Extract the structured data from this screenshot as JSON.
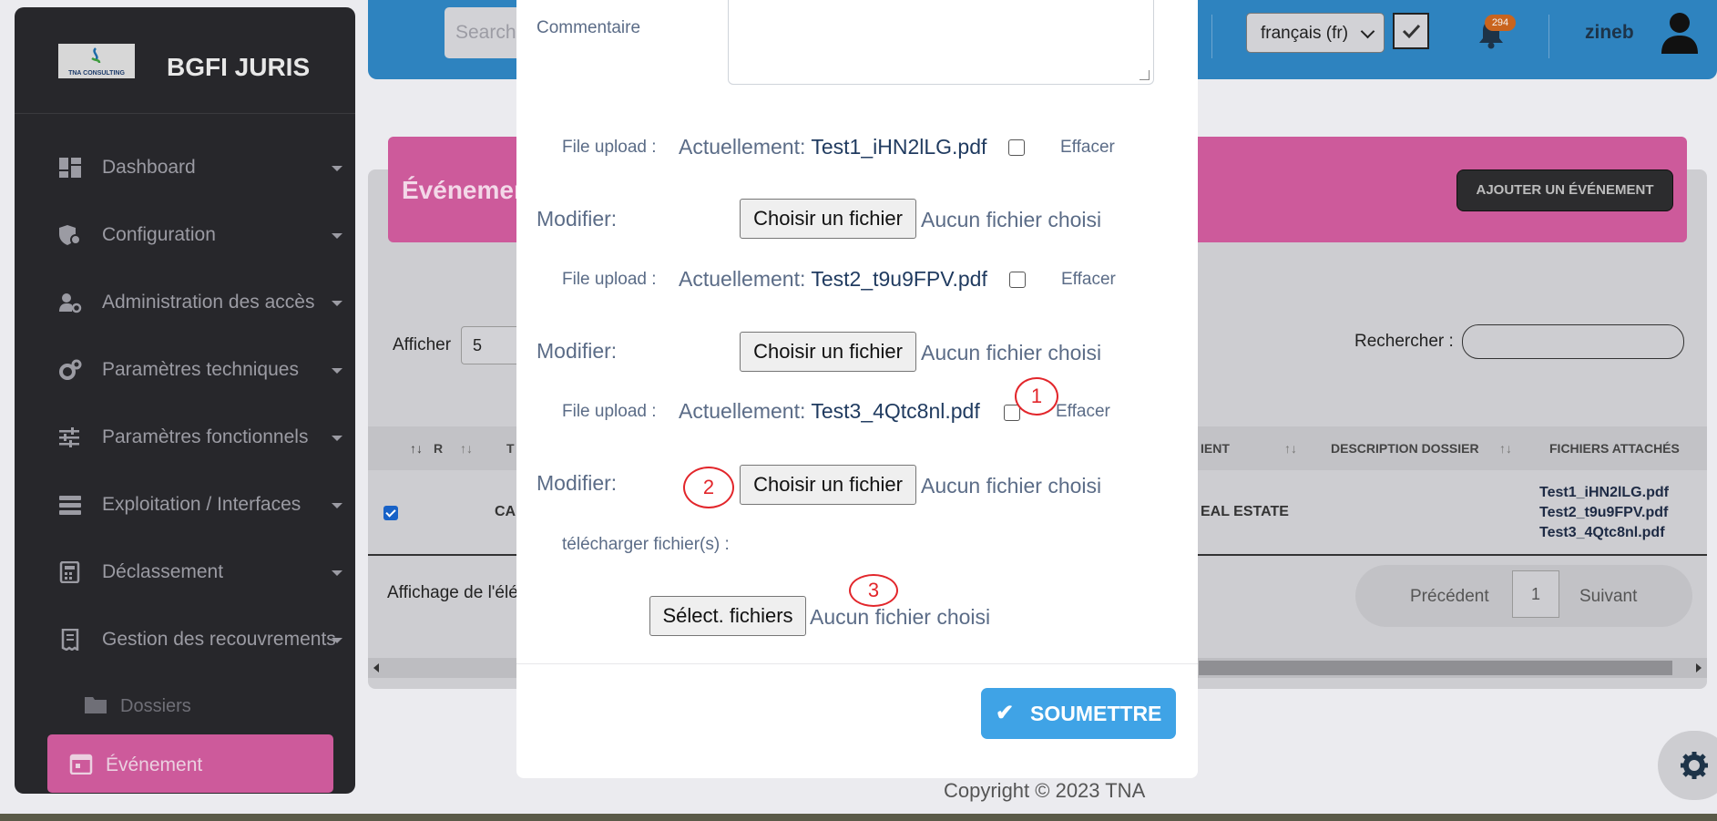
{
  "app": {
    "brand": "BGFI JURIS",
    "logo_text": "TNA CONSULTING"
  },
  "sidebar": {
    "items": [
      {
        "label": "Dashboard",
        "icon": "dashboard-icon"
      },
      {
        "label": "Configuration",
        "icon": "configuration-icon"
      },
      {
        "label": "Administration des accès",
        "icon": "user-gear-icon"
      },
      {
        "label": "Paramètres techniques",
        "icon": "gears-icon"
      },
      {
        "label": "Paramètres fonctionnels",
        "icon": "sliders-icon"
      },
      {
        "label": "Exploitation / Interfaces",
        "icon": "server-icon"
      },
      {
        "label": "Déclassement",
        "icon": "calculator-icon"
      },
      {
        "label": "Gestion des recouvrements",
        "icon": "receipt-icon"
      }
    ],
    "sub_item": {
      "label": "Dossiers",
      "icon": "folder-icon"
    },
    "active_item": {
      "label": "Événement",
      "icon": "calendar-icon"
    }
  },
  "topbar": {
    "search_placeholder": "Search",
    "language": "français (fr)",
    "notification_count": "294",
    "user_name": "zineb"
  },
  "page": {
    "title": "Événemen",
    "add_button": "AJOUTER UN ÉVÉNEMENT",
    "show_label": "Afficher",
    "page_size": "5",
    "search_label": "Rechercher :",
    "columns": [
      "R",
      "T",
      "IENT",
      "DESCRIPTION DOSSIER",
      "FICHIERS ATTACHÉS"
    ],
    "row": {
      "cell_type": "CA",
      "cell_client": "EAL ESTATE",
      "files": [
        "Test1_iHN2lLG.pdf",
        "Test2_t9u9FPV.pdf",
        "Test3_4Qtc8nl.pdf"
      ]
    },
    "info_text": "Affichage de l'élé",
    "pagination": {
      "previous": "Précédent",
      "current": "1",
      "next": "Suivant"
    },
    "copyright": "Copyright © 2023 TNA"
  },
  "modal": {
    "comment_label": "Commentaire",
    "uploads": [
      {
        "label": "File upload :",
        "current_prefix": "Actuellement:",
        "file": "Test1_iHN2lLG.pdf",
        "clear": "Effacer",
        "modify": "Modifier:",
        "choose": "Choisir un fichier",
        "no_file": "Aucun fichier choisi"
      },
      {
        "label": "File upload :",
        "current_prefix": "Actuellement:",
        "file": "Test2_t9u9FPV.pdf",
        "clear": "Effacer",
        "modify": "Modifier:",
        "choose": "Choisir un fichier",
        "no_file": "Aucun fichier choisi"
      },
      {
        "label": "File upload :",
        "current_prefix": "Actuellement:",
        "file": "Test3_4Qtc8nl.pdf",
        "clear": "Effacer",
        "modify": "Modifier:",
        "choose": "Choisir un fichier",
        "no_file": "Aucun fichier choisi"
      }
    ],
    "download_label": "télécharger fichier(s) :",
    "multi_button": "Sélect. fichiers",
    "multi_no_file": "Aucun fichier choisi",
    "submit_label": "SOUMETTRE",
    "submit_icon": "check-icon"
  },
  "annotations": [
    "1",
    "2",
    "3"
  ],
  "colors": {
    "sidebar": "#27272b",
    "accent_pink": "#cd5a9b",
    "topbar": "#2e83bf",
    "submit": "#3fa3e6",
    "annotation": "#e2262b"
  }
}
